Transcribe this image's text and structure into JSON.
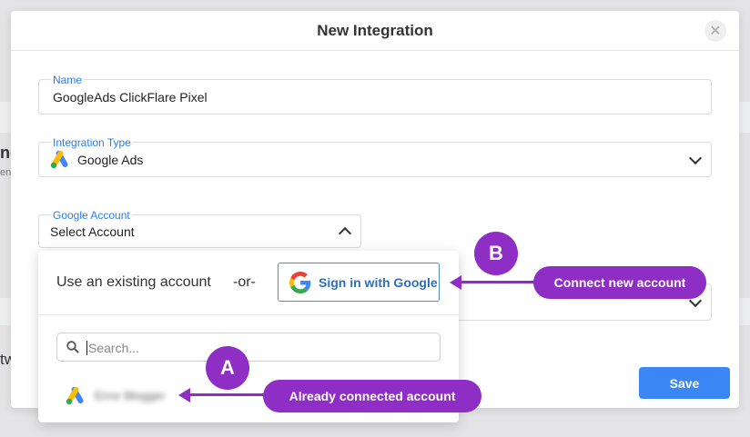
{
  "modal": {
    "title": "New Integration",
    "close_icon": "close-icon"
  },
  "name_field": {
    "label": "Name",
    "value": "GoogleAds ClickFlare Pixel"
  },
  "integration_type": {
    "label": "Integration Type",
    "value": "Google Ads",
    "icon": "google-ads-icon"
  },
  "google_account": {
    "label": "Google Account",
    "value": "Select Account"
  },
  "dropdown": {
    "use_existing": "Use an existing account",
    "or": "-or-",
    "sign_in_label": "Sign in with Google",
    "search_placeholder": "Search...",
    "accounts": [
      {
        "name": "Error Blogger"
      }
    ]
  },
  "footer": {
    "save_label": "Save"
  },
  "background": {
    "text_1": "ng",
    "text_2": "en",
    "text_3": "tw"
  },
  "annotations": {
    "badge_a": "A",
    "badge_b": "B",
    "pill_a": "Already connected account",
    "pill_b": "Connect new account",
    "color": "#8e2ec4"
  },
  "colors": {
    "accent": "#2b7de9",
    "save_button": "#3b86f5",
    "annotation": "#8e2ec4"
  }
}
